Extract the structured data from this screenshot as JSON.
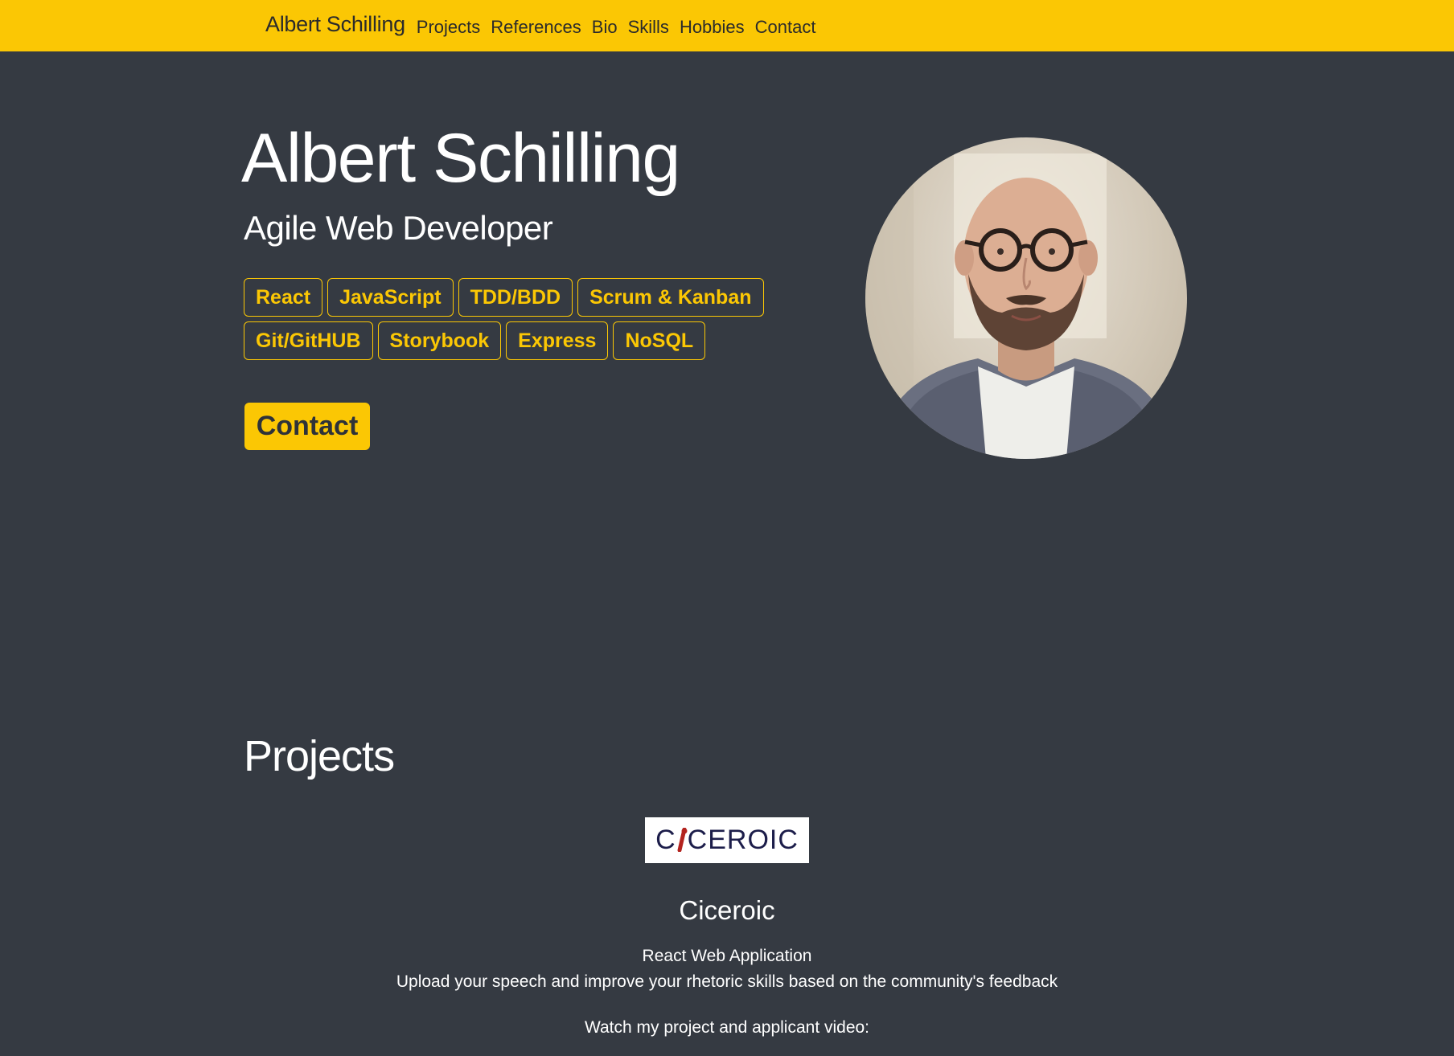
{
  "nav": {
    "brand": "Albert Schilling",
    "links": [
      "Projects",
      "References",
      "Bio",
      "Skills",
      "Hobbies",
      "Contact"
    ]
  },
  "hero": {
    "name": "Albert Schilling",
    "role": "Agile Web Developer",
    "skills_row1": [
      "React",
      "JavaScript",
      "TDD/BDD",
      "Scrum & Kanban"
    ],
    "skills_row2": [
      "Git/GitHUB",
      "Storybook",
      "Express",
      "NoSQL"
    ],
    "contact_button": "Contact",
    "avatar_alt": "Portrait photo"
  },
  "projects": {
    "heading": "Projects",
    "items": [
      {
        "logo_text_pre": "C",
        "logo_text_post": "CEROIC",
        "name": "Ciceroic",
        "type": "React Web Application",
        "description": "Upload your speech and improve your rhetoric skills based on the community's feedback",
        "video_prompt": "Watch my project and applicant video:"
      }
    ]
  },
  "colors": {
    "accent": "#fbc704",
    "background": "#353a42",
    "text": "#ffffff"
  }
}
